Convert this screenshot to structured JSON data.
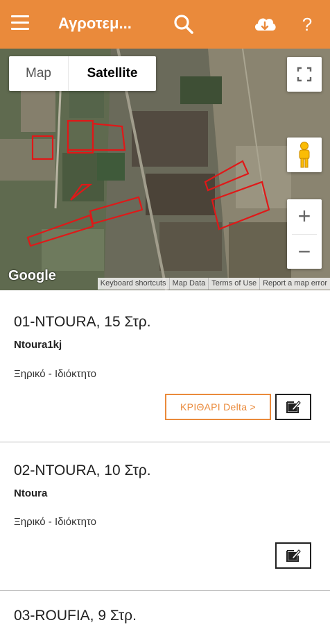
{
  "appbar": {
    "title": "Αγροτεμ...",
    "help_label": "?",
    "menu_icon": "hamburger-menu-icon",
    "search_icon": "search-icon",
    "download_icon": "cloud-download-icon"
  },
  "map": {
    "type_map_label": "Map",
    "type_satellite_label": "Satellite",
    "selected_type": "Satellite",
    "google_logo": "Google",
    "attribution": [
      "Keyboard shortcuts",
      "Map Data",
      "Terms of Use",
      "Report a map error"
    ],
    "zoom_in_label": "+",
    "zoom_out_label": "−"
  },
  "fields": [
    {
      "title": "01-NTOURA, 15 Στρ.",
      "subtitle": "Ntoura1kj",
      "description": "Ξηρικό - Ιδιόκτητο",
      "crop_label": "ΚΡΙΘΑΡΙ Delta >"
    },
    {
      "title": "02-NTOURA, 10 Στρ.",
      "subtitle": "Ntoura",
      "description": "Ξηρικό - Ιδιόκτητο"
    },
    {
      "title": "03-ROUFIA, 9 Στρ."
    }
  ],
  "colors": {
    "accent": "#ea8a3b",
    "field_outline": "#e01818"
  }
}
